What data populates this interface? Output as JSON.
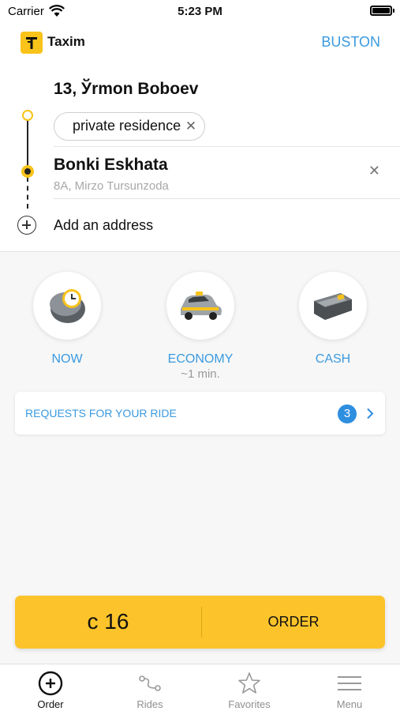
{
  "status_bar": {
    "carrier": "Carrier",
    "time": "5:23 PM"
  },
  "header": {
    "app_name": "Taxim",
    "city": "BUSTON"
  },
  "route": {
    "from": {
      "title": "13, Ўrmon Boboev",
      "chip": "private residence"
    },
    "to": {
      "title": "Bonki Eskhata",
      "subtitle": "8A, Mirzo Tursunzoda"
    },
    "add_address": "Add an address"
  },
  "options": [
    {
      "label": "NOW",
      "sub": "",
      "icon": "clock-icon"
    },
    {
      "label": "ECONOMY",
      "sub": "~1 min.",
      "icon": "taxi-car-icon"
    },
    {
      "label": "CASH",
      "sub": "",
      "icon": "wallet-icon"
    }
  ],
  "requests": {
    "label": "REQUESTS FOR YOUR RIDE",
    "count": "3"
  },
  "order": {
    "price": "c 16",
    "button": "ORDER"
  },
  "tabs": [
    {
      "label": "Order",
      "icon": "plus-circle-icon",
      "active": true
    },
    {
      "label": "Rides",
      "icon": "route-icon",
      "active": false
    },
    {
      "label": "Favorites",
      "icon": "star-icon",
      "active": false
    },
    {
      "label": "Menu",
      "icon": "menu-icon",
      "active": false
    }
  ],
  "colors": {
    "accent": "#3a9adf",
    "brand": "#fcc42a",
    "badge": "#2e8ee0"
  }
}
